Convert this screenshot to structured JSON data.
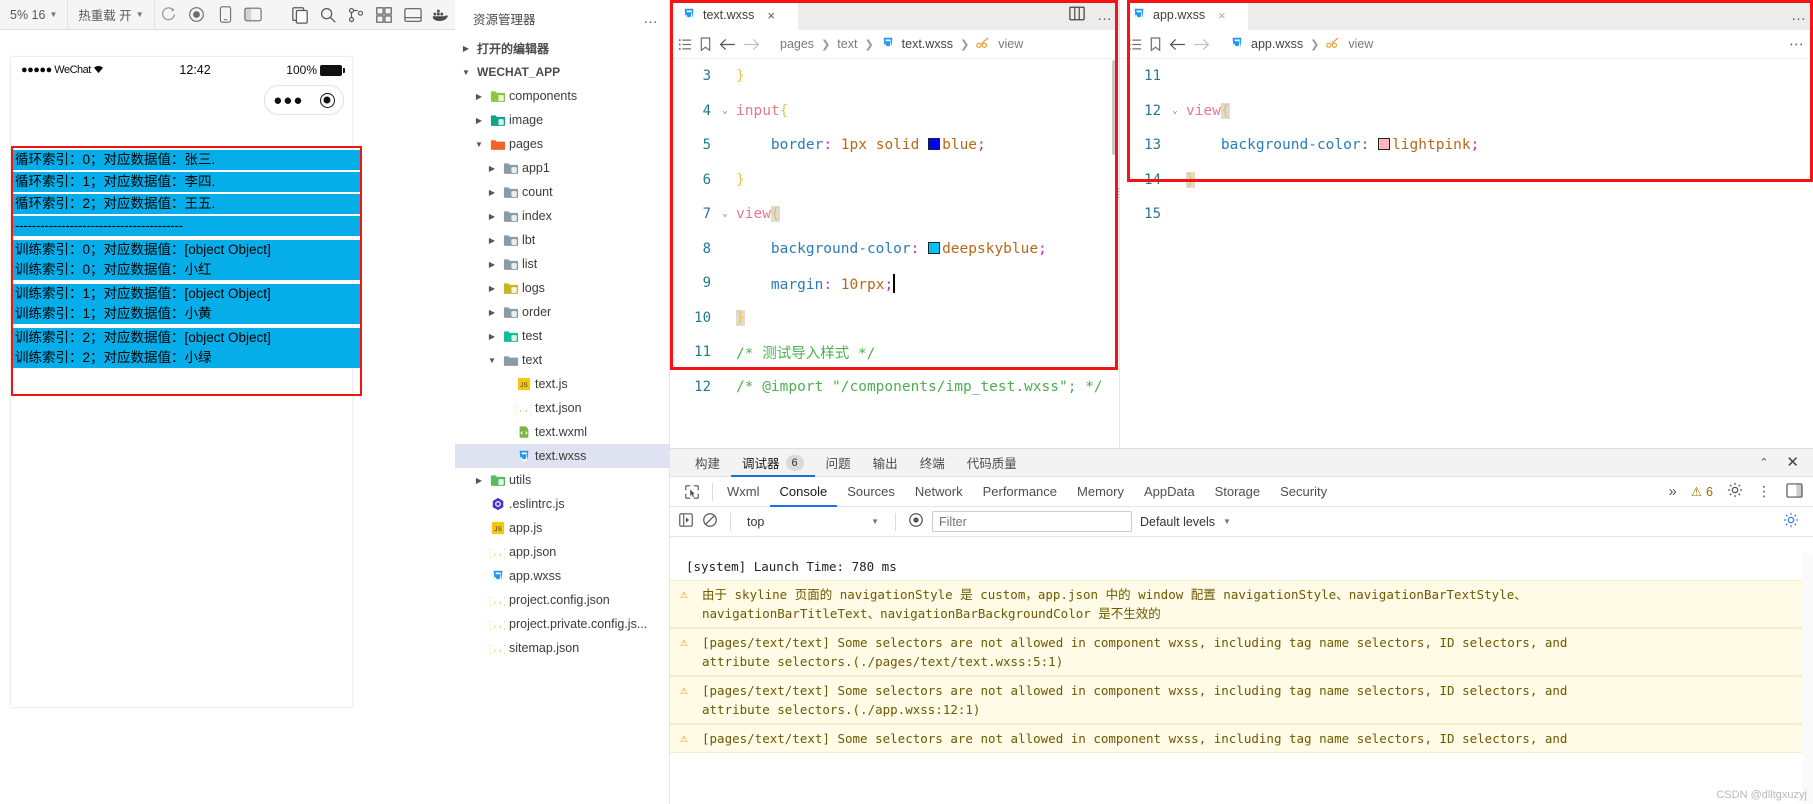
{
  "simulator": {
    "toolbar": {
      "zoom_label": "5% 16",
      "hotreload_label": "热重载 开",
      "icons": [
        "refresh-icon",
        "record-icon",
        "mobile-icon",
        "layout-icon"
      ]
    },
    "status_bar": {
      "carrier": "●●●●● WeChat",
      "wifi": "wifi-icon",
      "time": "12:42",
      "battery_pct": "100%"
    },
    "capsule": {
      "dots": "●●●",
      "target": "target-icon"
    },
    "accent_cyan": "#06aee9",
    "accent_red": "#f51414",
    "rows_group_a": [
      "循环索引：0；对应数据值：张三.",
      "循环索引：1；对应数据值：李四.",
      "循环索引：2；对应数据值：王五."
    ],
    "divider_row": "----------------------------------------",
    "rows_group_b": [
      [
        "训练索引：0；对应数据值：[object Object]",
        "训练索引：0；对应数据值：小红"
      ],
      [
        "训练索引：1；对应数据值：[object Object]",
        "训练索引：1；对应数据值：小黄"
      ],
      [
        "训练索引：2；对应数据值：[object Object]",
        "训练索引：2；对应数据值：小绿"
      ]
    ]
  },
  "explorer": {
    "title": "资源管理器",
    "more": "…",
    "open_editors": "打开的编辑器",
    "project": "WECHAT_APP",
    "tree": [
      {
        "label": "components",
        "type": "folder",
        "indent": 1,
        "expanded": false,
        "color": "#8dc63f"
      },
      {
        "label": "image",
        "type": "folder",
        "indent": 1,
        "expanded": false,
        "color": "#16a085"
      },
      {
        "label": "pages",
        "type": "folder",
        "indent": 1,
        "expanded": true,
        "color": "#f4622a"
      },
      {
        "label": "app1",
        "type": "folder",
        "indent": 2,
        "expanded": false,
        "color": "#8a9ba8"
      },
      {
        "label": "count",
        "type": "folder",
        "indent": 2,
        "expanded": false,
        "color": "#8a9ba8"
      },
      {
        "label": "index",
        "type": "folder",
        "indent": 2,
        "expanded": false,
        "color": "#8a9ba8"
      },
      {
        "label": "lbt",
        "type": "folder",
        "indent": 2,
        "expanded": false,
        "color": "#8a9ba8"
      },
      {
        "label": "list",
        "type": "folder",
        "indent": 2,
        "expanded": false,
        "color": "#8a9ba8"
      },
      {
        "label": "logs",
        "type": "folder",
        "indent": 2,
        "expanded": false,
        "color": "#c4b82a"
      },
      {
        "label": "order",
        "type": "folder",
        "indent": 2,
        "expanded": false,
        "color": "#8a9ba8"
      },
      {
        "label": "test",
        "type": "folder",
        "indent": 2,
        "expanded": false,
        "color": "#13bf96"
      },
      {
        "label": "text",
        "type": "folder",
        "indent": 2,
        "expanded": true,
        "color": "#8a9ba8"
      },
      {
        "label": "text.js",
        "type": "js",
        "indent": 3,
        "selected": false
      },
      {
        "label": "text.json",
        "type": "json",
        "indent": 3,
        "selected": false
      },
      {
        "label": "text.wxml",
        "type": "wxml",
        "indent": 3,
        "selected": false
      },
      {
        "label": "text.wxss",
        "type": "wxss",
        "indent": 3,
        "selected": true
      },
      {
        "label": "utils",
        "type": "folder",
        "indent": 1,
        "expanded": false,
        "color": "#5cb85c"
      },
      {
        "label": ".eslintrc.js",
        "type": "eslint",
        "indent": 1,
        "selected": false
      },
      {
        "label": "app.js",
        "type": "js",
        "indent": 1,
        "selected": false
      },
      {
        "label": "app.json",
        "type": "json",
        "indent": 1,
        "selected": false
      },
      {
        "label": "app.wxss",
        "type": "wxss",
        "indent": 1,
        "selected": false
      },
      {
        "label": "project.config.json",
        "type": "json",
        "indent": 1,
        "selected": false
      },
      {
        "label": "project.private.config.js...",
        "type": "json",
        "indent": 1,
        "selected": false
      },
      {
        "label": "sitemap.json",
        "type": "json",
        "indent": 1,
        "selected": false
      }
    ]
  },
  "editor_left": {
    "tab_label": "text.wxss",
    "tab_close": "×",
    "breadcrumb": [
      "pages",
      "text",
      "text.wxss",
      "view"
    ],
    "lines": [
      {
        "num": "3",
        "fold": "",
        "html": "<span class=\"k-brace\">}</span>"
      },
      {
        "num": "4",
        "fold": "⌄",
        "html": "<span class=\"k-sel\">input</span><span class=\"k-brace\">{</span>"
      },
      {
        "num": "5",
        "fold": "",
        "html": "    <span class=\"k-prop\">border</span><span class=\"k-punc\">:</span> <span class=\"k-num\">1px</span> <span class=\"k-val\">solid</span> <span class=\"swatch\" style=\"background:#0000ff\"></span><span class=\"k-val\">blue</span><span class=\"k-punc\">;</span>"
      },
      {
        "num": "6",
        "fold": "",
        "html": "<span class=\"k-brace\">}</span>"
      },
      {
        "num": "7",
        "fold": "⌄",
        "html": "<span class=\"k-sel\">view</span><span class=\"k-brace brace-hl\">{</span>"
      },
      {
        "num": "8",
        "fold": "",
        "html": "    <span class=\"k-prop\">background-color</span><span class=\"k-punc\">:</span> <span class=\"swatch\" style=\"background:#00bfff\"></span><span class=\"k-val\">deepskyblue</span><span class=\"k-punc\">;</span>"
      },
      {
        "num": "9",
        "fold": "",
        "html": "    <span class=\"k-prop\">margin</span><span class=\"k-punc\">:</span> <span class=\"k-num\">10rpx</span><span class=\"k-punc\">;</span><span class=\"caret-bar\"></span>"
      },
      {
        "num": "10",
        "fold": "",
        "html": "<span class=\"k-brace brace-hl\">}</span>"
      },
      {
        "num": "11",
        "fold": "",
        "html": "<span class=\"k-comment\">/* 测试导入样式 */</span>"
      },
      {
        "num": "12",
        "fold": "",
        "html": "<span class=\"k-comment\">/* @import \"/components/imp_test.wxss\"; */</span>"
      }
    ]
  },
  "editor_right": {
    "tab_label": "app.wxss",
    "tab_close": "×",
    "breadcrumb": [
      "app.wxss",
      "view"
    ],
    "lines": [
      {
        "num": "11",
        "fold": "",
        "html": ""
      },
      {
        "num": "12",
        "fold": "⌄",
        "html": "<span class=\"k-sel\">view</span><span class=\"k-brace brace-hl\">{</span>"
      },
      {
        "num": "13",
        "fold": "",
        "html": "    <span class=\"k-prop\">background-color</span><span class=\"k-punc\">:</span> <span class=\"swatch\" style=\"background:#ffb6c1\"></span><span class=\"k-val\">lightpink</span><span class=\"k-punc\">;</span>"
      },
      {
        "num": "14",
        "fold": "",
        "html": "<span class=\"k-brace brace-hl\">}</span>"
      },
      {
        "num": "15",
        "fold": "",
        "html": ""
      }
    ]
  },
  "devtools": {
    "panel_tabs": [
      {
        "label": "构建",
        "badge": "",
        "active": false
      },
      {
        "label": "调试器",
        "badge": "6",
        "active": true
      },
      {
        "label": "问题",
        "badge": "",
        "active": false
      },
      {
        "label": "输出",
        "badge": "",
        "active": false
      },
      {
        "label": "终端",
        "badge": "",
        "active": false
      },
      {
        "label": "代码质量",
        "badge": "",
        "active": false
      }
    ],
    "panel_actions": [
      "chevron-up-icon",
      "close-icon"
    ],
    "devtool_tabs": [
      {
        "label": "Wxml",
        "active": false
      },
      {
        "label": "Console",
        "active": true
      },
      {
        "label": "Sources",
        "active": false
      },
      {
        "label": "Network",
        "active": false
      },
      {
        "label": "Performance",
        "active": false
      },
      {
        "label": "Memory",
        "active": false
      },
      {
        "label": "AppData",
        "active": false
      },
      {
        "label": "Storage",
        "active": false
      },
      {
        "label": "Security",
        "active": false
      }
    ],
    "overflow": "»",
    "warning_count": "6",
    "console": {
      "context": "top",
      "filter_placeholder": "Filter",
      "levels": "Default levels",
      "messages": [
        {
          "type": "system",
          "text": "[system] Launch Time: 780 ms"
        },
        {
          "type": "warn",
          "text": "由于 skyline 页面的 navigationStyle 是 custom，app.json 中的 window 配置 navigationStyle、navigationBarTextStyle、\nnavigationBarTitleText、navigationBarBackgroundColor 是不生效的"
        },
        {
          "type": "warn",
          "text": "[pages/text/text] Some selectors are not allowed in component wxss, including tag name selectors, ID selectors, and\nattribute selectors.(./pages/text/text.wxss:5:1)"
        },
        {
          "type": "warn",
          "text": "[pages/text/text] Some selectors are not allowed in component wxss, including tag name selectors, ID selectors, and\nattribute selectors.(./app.wxss:12:1)"
        },
        {
          "type": "warn",
          "text": "[pages/text/text] Some selectors are not allowed in component wxss, including tag name selectors, ID selectors, and"
        }
      ]
    }
  },
  "watermark": "CSDN @dlltgxuzyj"
}
